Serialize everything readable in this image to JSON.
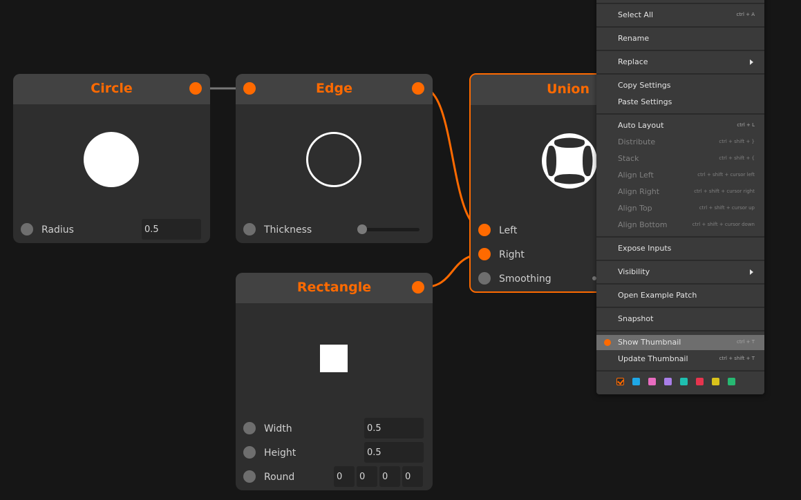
{
  "colors": {
    "accent": "#ff6a00",
    "canvas": "#161616",
    "node_body": "#2e2e2e",
    "node_header": "#424242",
    "menu_bg": "#3a3a3a"
  },
  "nodes": {
    "circle": {
      "title": "Circle",
      "params": [
        {
          "label": "Radius",
          "value": "0.5"
        }
      ]
    },
    "edge": {
      "title": "Edge",
      "params": [
        {
          "label": "Thickness",
          "slider_value": 0.0
        }
      ]
    },
    "union": {
      "title": "Union",
      "params": [
        {
          "label": "Left"
        },
        {
          "label": "Right"
        },
        {
          "label": "Smoothing"
        }
      ]
    },
    "rectangle": {
      "title": "Rectangle",
      "params": [
        {
          "label": "Width",
          "value": "0.5"
        },
        {
          "label": "Height",
          "value": "0.5"
        },
        {
          "label": "Round",
          "values": [
            "0",
            "0",
            "0",
            "0"
          ]
        }
      ]
    }
  },
  "context_menu": {
    "items": [
      {
        "label": "Select All",
        "shortcut": "ctrl + A"
      },
      {
        "label": "Rename"
      },
      {
        "label": "Replace",
        "submenu": true
      },
      {
        "label": "Copy Settings"
      },
      {
        "label": "Paste Settings"
      },
      {
        "label": "Auto Layout",
        "shortcut": "ctrl + L"
      },
      {
        "label": "Distribute",
        "shortcut": "ctrl + shift + }",
        "disabled": true
      },
      {
        "label": "Stack",
        "shortcut": "ctrl + shift + {",
        "disabled": true
      },
      {
        "label": "Align Left",
        "shortcut": "ctrl + shift + cursor left",
        "disabled": true
      },
      {
        "label": "Align Right",
        "shortcut": "ctrl + shift + cursor right",
        "disabled": true
      },
      {
        "label": "Align Top",
        "shortcut": "ctrl + shift + cursor up",
        "disabled": true
      },
      {
        "label": "Align Bottom",
        "shortcut": "ctrl + shift + cursor down",
        "disabled": true
      },
      {
        "label": "Expose Inputs"
      },
      {
        "label": "Visibility",
        "submenu": true
      },
      {
        "label": "Open Example Patch"
      },
      {
        "label": "Snapshot"
      },
      {
        "label": "Show Thumbnail",
        "shortcut": "ctrl + T",
        "checked": true
      },
      {
        "label": "Update Thumbnail",
        "shortcut": "ctrl + shift + T"
      }
    ],
    "swatches": [
      "#ff6a00",
      "#1ea7e6",
      "#e86cc0",
      "#a97ee8",
      "#1fbfb0",
      "#e6344e",
      "#d9c21b",
      "#27b872"
    ],
    "selected_swatch": 0
  }
}
